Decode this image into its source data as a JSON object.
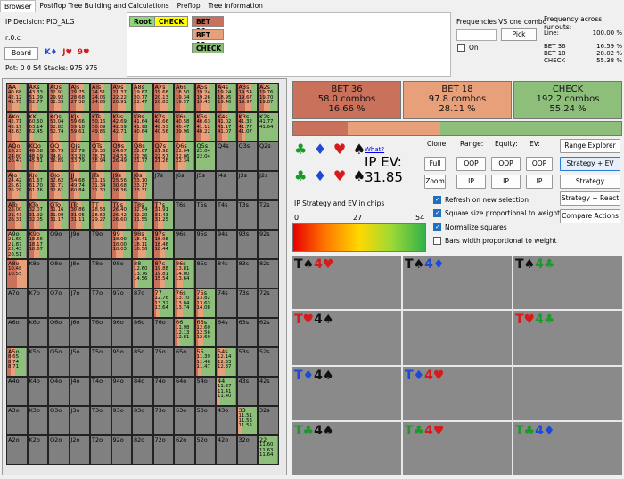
{
  "tabs": [
    "Browser",
    "Postflop Tree Building and Calculations",
    "Preflop",
    "Tree information"
  ],
  "left_info": {
    "ip_decision": "IP Decision:   PIO_ALG",
    "path": "r:0:c",
    "board_button": "Board",
    "board_cards": [
      {
        "text": "K♦",
        "color": "#1c49d8"
      },
      {
        "text": "J♥",
        "color": "#d71a1a"
      },
      {
        "text": "9♥",
        "color": "#d71a1a"
      }
    ],
    "pot_stacks": "Pot: 0 0 54 Stacks: 975 975"
  },
  "tree": {
    "root": "Root",
    "check": "CHECK",
    "bet36": "BET 36",
    "bet18": "BET 18",
    "check2": "CHECK"
  },
  "freq_one": {
    "title": "Frequencies VS one combo",
    "pick": "Pick",
    "on": "On"
  },
  "freq_runouts": {
    "title": "Frequency across runouts:",
    "rows": [
      {
        "label": "Line:",
        "value": "100.00 %"
      },
      {
        "label": "BET 36",
        "value": "16.59 %"
      },
      {
        "label": "BET 18",
        "value": "28.02 %"
      },
      {
        "label": "CHECK",
        "value": "55.38 %"
      }
    ]
  },
  "strategy": {
    "actions": [
      {
        "name": "BET 36",
        "combos": "58.0 combos",
        "pct": "16.66 %",
        "share": 16.66,
        "color": "#c9715a"
      },
      {
        "name": "BET 18",
        "combos": "97.8 combos",
        "pct": "28.11 %",
        "share": 28.11,
        "color": "#e8a07a"
      },
      {
        "name": "CHECK",
        "combos": "192.2 combos",
        "pct": "55.24 %",
        "share": 55.24,
        "color": "#8dbf7a"
      }
    ]
  },
  "ev_panel": {
    "what": "What?",
    "ip_ev_label": "IP EV:",
    "ip_ev_value": "31.85",
    "clone": "Clone:",
    "range": "Range:",
    "equity": "Equity:",
    "ev": "EV:",
    "full": "Full",
    "zoom": "Zoom",
    "oop": "OOP",
    "ip": "IP",
    "legend_title": "IP Strategy and EV in chips",
    "legend_min": "0",
    "legend_mid": "27",
    "legend_max": "54"
  },
  "right_buttons": [
    "Range Explorer",
    "Strategy + EV",
    "Strategy",
    "Strategy + React",
    "Compare Actions"
  ],
  "checkboxes": [
    {
      "label": "Refresh on new selection",
      "checked": true
    },
    {
      "label": "Square size proportional to weight",
      "checked": true
    },
    {
      "label": "Normalize squares",
      "checked": true
    },
    {
      "label": "Bars width proportional to weight",
      "checked": false
    }
  ],
  "runouts": [
    {
      "cards": [
        {
          "t": "T♠",
          "c": "blk"
        },
        {
          "t": "4♥",
          "c": "red"
        }
      ]
    },
    {
      "cards": [
        {
          "t": "T♠",
          "c": "blk"
        },
        {
          "t": "4♦",
          "c": "blue"
        }
      ]
    },
    {
      "cards": [
        {
          "t": "T♠",
          "c": "blk"
        },
        {
          "t": "4♣",
          "c": "green"
        }
      ]
    },
    {
      "cards": [
        {
          "t": "T♥",
          "c": "red"
        },
        {
          "t": "4♠",
          "c": "blk"
        }
      ]
    },
    {
      "cards": [
        {
          "t": "",
          "c": "blk"
        }
      ]
    },
    {
      "cards": [
        {
          "t": "T♥",
          "c": "red"
        },
        {
          "t": "4♣",
          "c": "green"
        }
      ]
    },
    {
      "cards": [
        {
          "t": "T♦",
          "c": "blue"
        },
        {
          "t": "4♠",
          "c": "blk"
        }
      ]
    },
    {
      "cards": [
        {
          "t": "T♦",
          "c": "blue"
        },
        {
          "t": "4♥",
          "c": "red"
        }
      ]
    },
    {
      "cards": [
        {
          "t": "",
          "c": "blk"
        }
      ]
    },
    {
      "cards": [
        {
          "t": "T♣",
          "c": "green"
        },
        {
          "t": "4♠",
          "c": "blk"
        }
      ]
    },
    {
      "cards": [
        {
          "t": "T♣",
          "c": "green"
        },
        {
          "t": "4♥",
          "c": "red"
        }
      ]
    },
    {
      "cards": [
        {
          "t": "T♣",
          "c": "green"
        },
        {
          "t": "4♦",
          "c": "blue"
        }
      ]
    }
  ],
  "matrix": {
    "ranks": [
      "A",
      "K",
      "Q",
      "J",
      "T",
      "9",
      "8",
      "7",
      "6",
      "5",
      "4",
      "3",
      "2"
    ],
    "cells": [
      [
        "AA",
        "AKs",
        "AQs",
        "AJs",
        "ATs",
        "A9s",
        "A8s",
        "A7s",
        "A6s",
        "A5s",
        "A4s",
        "A3s",
        "A2s"
      ],
      [
        "AKo",
        "KK",
        "KQs",
        "KJs",
        "KTs",
        "K9s",
        "K8s",
        "K7s",
        "K6s",
        "K5s",
        "K4s",
        "K3s",
        "K2s"
      ],
      [
        "AQo",
        "KQo",
        "QQ",
        "QJs",
        "QTs",
        "Q9s",
        "Q8s",
        "Q7s",
        "Q6s",
        "Q5s",
        "Q4s",
        "Q3s",
        "Q2s"
      ],
      [
        "AJo",
        "KJo",
        "QJo",
        "JJ",
        "JTs",
        "J9s",
        "J8s",
        "J7s",
        "J6s",
        "J5s",
        "J4s",
        "J3s",
        "J2s"
      ],
      [
        "ATo",
        "KTo",
        "QTo",
        "JTo",
        "TT",
        "T9s",
        "T8s",
        "T7s",
        "T6s",
        "T5s",
        "T4s",
        "T3s",
        "T2s"
      ],
      [
        "A9o",
        "K9o",
        "Q9o",
        "J9o",
        "T9o",
        "99",
        "98s",
        "97s",
        "96s",
        "95s",
        "94s",
        "93s",
        "92s"
      ],
      [
        "A8o",
        "K8o",
        "Q8o",
        "J8o",
        "T8o",
        "98o",
        "88",
        "87s",
        "86s",
        "85s",
        "84s",
        "83s",
        "82s"
      ],
      [
        "A7o",
        "K7o",
        "Q7o",
        "J7o",
        "T7o",
        "97o",
        "87o",
        "77",
        "76s",
        "75s",
        "74s",
        "73s",
        "72s"
      ],
      [
        "A6o",
        "K6o",
        "Q6o",
        "J6o",
        "T6o",
        "96o",
        "86o",
        "76o",
        "66",
        "65s",
        "64s",
        "63s",
        "62s"
      ],
      [
        "A5o",
        "K5o",
        "Q5o",
        "J5o",
        "T5o",
        "95o",
        "85o",
        "75o",
        "65o",
        "55",
        "54s",
        "53s",
        "52s"
      ],
      [
        "A4o",
        "K4o",
        "Q4o",
        "J4o",
        "T4o",
        "94o",
        "84o",
        "74o",
        "64o",
        "54o",
        "44",
        "43s",
        "42s"
      ],
      [
        "A3o",
        "K3o",
        "Q3o",
        "J3o",
        "T3o",
        "93o",
        "83o",
        "73o",
        "63o",
        "53o",
        "43o",
        "33",
        "32s"
      ],
      [
        "A2o",
        "K2o",
        "Q2o",
        "J2o",
        "T2o",
        "92o",
        "82o",
        "72o",
        "62o",
        "52o",
        "42o",
        "32o",
        "22"
      ]
    ],
    "colored": {
      "0,0": {
        "nums": "40.68\n42.12\n41.75",
        "mix": [
          30,
          30,
          40
        ]
      },
      "0,1": {
        "nums": "43.33\n51.09\n52.77",
        "mix": [
          20,
          30,
          50
        ]
      },
      "0,2": {
        "nums": "32.91\n29.92\n32.33",
        "mix": [
          30,
          30,
          40
        ]
      },
      "0,3": {
        "nums": "29.75\n28.68\n27.38",
        "mix": [
          30,
          40,
          30
        ]
      },
      "0,4": {
        "nums": "24.51\n24.06\n24.86",
        "mix": [
          40,
          30,
          30
        ]
      },
      "0,5": {
        "nums": "21.37\n22.22\n20.91",
        "mix": [
          30,
          40,
          30
        ]
      },
      "0,6": {
        "nums": "19.67\n20.77\n22.47",
        "mix": [
          20,
          40,
          40
        ]
      },
      "0,7": {
        "nums": "19.68\n20.13\n20.83",
        "mix": [
          30,
          40,
          30
        ]
      },
      "0,8": {
        "nums": "18.50\n19.34\n19.57",
        "mix": [
          30,
          30,
          40
        ]
      },
      "0,9": {
        "nums": "19.24\n19.26\n19.43",
        "mix": [
          30,
          40,
          30
        ]
      },
      "0,10": {
        "nums": "19.24\n18.95\n19.46",
        "mix": [
          30,
          30,
          40
        ]
      },
      "0,11": {
        "nums": "19.54\n19.67\n19.97",
        "mix": [
          40,
          30,
          30
        ]
      },
      "0,12": {
        "nums": "19.76\n19.70\n19.87",
        "mix": [
          30,
          30,
          40
        ]
      },
      "1,0": {
        "nums": "42.71\n43.17\n43.63",
        "mix": [
          30,
          30,
          40
        ]
      },
      "1,1": {
        "nums": "60.50\n63.14\n62.45",
        "mix": [
          10,
          20,
          70
        ]
      },
      "1,2": {
        "nums": "53.04\n52.82\n52.74",
        "mix": [
          20,
          30,
          50
        ]
      },
      "1,3": {
        "nums": "59.66\n59.18\n59.61",
        "mix": [
          30,
          30,
          40
        ]
      },
      "1,4": {
        "nums": "50.16\n50.09\n49.86",
        "mix": [
          40,
          30,
          30
        ]
      },
      "1,5": {
        "nums": "42.69\n42.59\n42.71",
        "mix": [
          30,
          30,
          40
        ]
      },
      "1,6": {
        "nums": "41.64\n41.98\n40.64",
        "mix": [
          30,
          30,
          40
        ]
      },
      "1,7": {
        "nums": "40.66\n40.53\n40.56",
        "mix": [
          30,
          40,
          30
        ]
      },
      "1,8": {
        "nums": "40.58\n40.47\n39.96",
        "mix": [
          30,
          30,
          40
        ]
      },
      "1,9": {
        "nums": "40.63\n41.12\n40.22",
        "mix": [
          30,
          40,
          30
        ]
      },
      "1,10": {
        "nums": "41.02\n41.17\n41.07",
        "mix": [
          30,
          30,
          40
        ]
      },
      "1,11": {
        "nums": "41.32\n41.77\n41.07",
        "mix": [
          20,
          20,
          60
        ]
      },
      "1,12": {
        "nums": "41.77\n41.64",
        "mix": [
          0,
          0,
          100
        ]
      },
      "2,0": {
        "nums": "26.25\n24.80\n26.47",
        "mix": [
          40,
          30,
          30
        ]
      },
      "2,1": {
        "nums": "46.08\n48.19\n45.81",
        "mix": [
          30,
          30,
          40
        ]
      },
      "2,2": {
        "nums": "36.79\n34.61\n36.85",
        "mix": [
          30,
          40,
          30
        ]
      },
      "2,3": {
        "nums": "32.79\n33.20\n33.79",
        "mix": [
          20,
          30,
          50
        ]
      },
      "2,4": {
        "nums": "39.30\n38.73\n38.94",
        "mix": [
          30,
          40,
          30
        ]
      },
      "2,5": {
        "nums": "24.67\n24.53\n26.49",
        "mix": [
          40,
          30,
          30
        ]
      },
      "2,6": {
        "nums": "22.67\n22.36\n21.77",
        "mix": [
          30,
          30,
          40
        ]
      },
      "2,7": {
        "nums": "21.98\n22.57\n21.26",
        "mix": [
          30,
          40,
          30
        ]
      },
      "2,8": {
        "nums": "22.04\n22.06\n22.34",
        "mix": [
          20,
          40,
          40
        ]
      },
      "2,9": {
        "nums": "22.04\n22.04",
        "mix": [
          0,
          0,
          100
        ]
      },
      "3,0": {
        "nums": "24.42\n25.67\n26.29",
        "mix": [
          30,
          30,
          40
        ]
      },
      "3,1": {
        "nums": "61.67\n61.70\n61.76",
        "mix": [
          20,
          30,
          50
        ]
      },
      "3,2": {
        "nums": "32.62\n32.71\n32.61",
        "mix": [
          30,
          30,
          40
        ]
      },
      "3,3": {
        "nums": "54.68\n49.74\n60.84",
        "mix": [
          20,
          30,
          50
        ]
      },
      "3,4": {
        "nums": "31.15\n31.34\n31.30",
        "mix": [
          30,
          40,
          30
        ]
      },
      "3,5": {
        "nums": "25.56\n30.68\n26.36",
        "mix": [
          40,
          30,
          30
        ]
      },
      "3,6": {
        "nums": "23.10\n23.17\n23.31",
        "mix": [
          30,
          40,
          30
        ]
      },
      "4,0": {
        "nums": "25.00\n21.43\n26.31",
        "mix": [
          40,
          30,
          30
        ]
      },
      "4,1": {
        "nums": "32.07\n31.92\n32.05",
        "mix": [
          30,
          30,
          40
        ]
      },
      "4,2": {
        "nums": "31.16\n31.09\n31.17",
        "mix": [
          30,
          40,
          30
        ]
      },
      "4,3": {
        "nums": "30.86\n31.05\n31.11",
        "mix": [
          30,
          30,
          40
        ]
      },
      "4,4": {
        "nums": "28.53\n28.60\n29.27",
        "mix": [
          20,
          40,
          40
        ]
      },
      "4,5": {
        "nums": "26.40\n26.42\n26.60",
        "mix": [
          30,
          40,
          30
        ]
      },
      "4,6": {
        "nums": "32.54\n32.20\n31.55",
        "mix": [
          30,
          30,
          40
        ]
      },
      "4,7": {
        "nums": "31.91\n31.43\n31.25",
        "mix": [
          20,
          30,
          50
        ]
      },
      "5,0": {
        "nums": "21.69\n21.87\n22.43\n20.51",
        "mix": [
          10,
          20,
          70
        ]
      },
      "5,1": {
        "nums": "18.66\n18.17\n18.67",
        "mix": [
          30,
          30,
          40
        ]
      },
      "5,5": {
        "nums": "18.00\n18.00\n18.03",
        "mix": [
          20,
          40,
          40
        ]
      },
      "5,6": {
        "nums": "18.41\n18.11\n18.56",
        "mix": [
          30,
          40,
          30
        ]
      },
      "5,7": {
        "nums": "18.98\n18.46\n18.44",
        "mix": [
          30,
          30,
          40
        ]
      },
      "6,0": {
        "nums": "10.48\n10.55",
        "mix": [
          50,
          50,
          0
        ]
      },
      "6,6": {
        "nums": "12.60\n13.76\n14.56",
        "mix": [
          10,
          20,
          70
        ]
      },
      "6,7": {
        "nums": "19.88\n19.81\n15.54",
        "mix": [
          30,
          30,
          40
        ]
      },
      "6,8": {
        "nums": "13.81\n14.00\n13.64",
        "mix": [
          10,
          30,
          60
        ]
      },
      "7,7": {
        "nums": "12.76\n13.32\n13.64",
        "mix": [
          10,
          20,
          70
        ]
      },
      "7,8": {
        "nums": "13.70\n13.84\n13.74",
        "mix": [
          10,
          30,
          60
        ]
      },
      "7,9": {
        "nums": "13.82\n13.63\n14.08",
        "mix": [
          10,
          30,
          60
        ]
      },
      "8,8": {
        "nums": "11.98\n12.13\n12.81",
        "mix": [
          10,
          20,
          70
        ]
      },
      "8,9": {
        "nums": "12.60\n12.56\n12.60",
        "mix": [
          10,
          30,
          60
        ]
      },
      "9,0": {
        "nums": "8.65\n8.74\n8.71",
        "mix": [
          20,
          20,
          60
        ]
      },
      "9,9": {
        "nums": "11.39\n11.46\n11.47",
        "mix": [
          10,
          20,
          70
        ]
      },
      "9,10": {
        "nums": "12.14\n12.33\n12.37",
        "mix": [
          10,
          30,
          60
        ]
      },
      "10,10": {
        "nums": "11.37\n11.41\n11.40",
        "mix": [
          0,
          20,
          80
        ]
      },
      "11,11": {
        "nums": "11.51\n11.53\n11.55",
        "mix": [
          0,
          20,
          80
        ]
      },
      "12,12": {
        "nums": "11.60\n11.63\n11.64",
        "mix": [
          0,
          10,
          90
        ]
      }
    }
  }
}
